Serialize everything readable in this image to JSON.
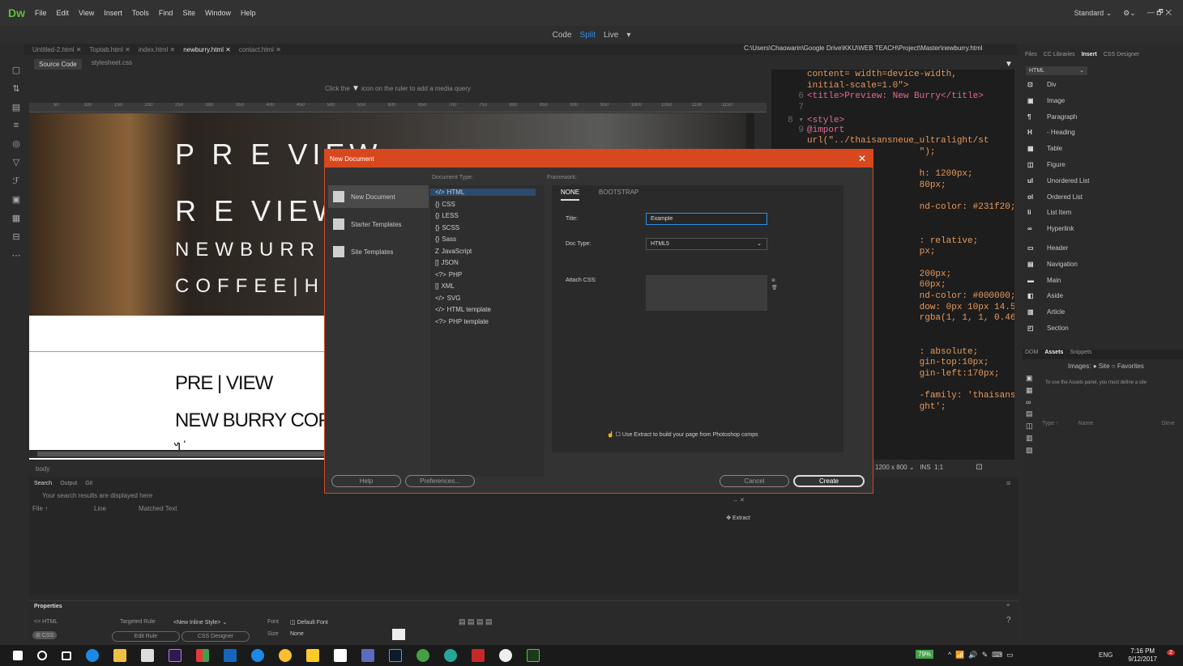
{
  "app": {
    "logo": "Dw",
    "menu": [
      "File",
      "Edit",
      "View",
      "Insert",
      "Tools",
      "Find",
      "Site",
      "Window",
      "Help"
    ],
    "workspace": "Standard",
    "workspace_caret": "⌄",
    "sync_icon": "⚙⌄",
    "win_controls": "—   🗗   ✕"
  },
  "view_modes": {
    "code": "Code",
    "split": "Split",
    "live": "Live",
    "caret": "▾"
  },
  "tabs": [
    "Untitled-2.html",
    "Toptab.html",
    "index.html",
    "newburry.html",
    "contact.html"
  ],
  "tab_close": "✕",
  "active_tab": "newburry.html",
  "file_path": "C:\\Users\\Chaowarin\\Google Drive\\KKU\\WEB TEACH\\Project\\Master\\newburry.html",
  "filter_icon": "▼",
  "sub_tabs": {
    "source": "Source Code",
    "css": "stylesheet.css"
  },
  "media_query_hint": {
    "before": "Click the",
    "after": "icon on the ruler to add a media query"
  },
  "ruler_ticks": [
    "50",
    "100",
    "150",
    "200",
    "250",
    "300",
    "350",
    "400",
    "450",
    "500",
    "550",
    "600",
    "650",
    "700",
    "750",
    "800",
    "850",
    "900",
    "950",
    "1000",
    "1050",
    "1100",
    "1150"
  ],
  "page": {
    "h1": "P R E VIEW",
    "h2": "R   E VIEW",
    "h3": "NEWBURR",
    "h4": "COFFEE|H",
    "lower1": "PRE | VIEW",
    "lower2": "NEW BURRY COF",
    "lower3": "ไ   ่ .   ."
  },
  "code_lines": [
    {
      "n": "",
      "t": "content= width=device-width,"
    },
    {
      "n": "",
      "t": "initial-scale=1.0\">"
    },
    {
      "n": "6",
      "t": "<title>Preview: New Burry</title>"
    },
    {
      "n": "7",
      "t": ""
    },
    {
      "n": "8 ▾",
      "t": "<style>"
    },
    {
      "n": "9",
      "t": "@import"
    },
    {
      "n": "",
      "t": "url(\"../thaisansneue_ultralight/st"
    },
    {
      "n": "",
      "t": "                     \");"
    },
    {
      "n": "",
      "t": ""
    },
    {
      "n": "",
      "t": "                     h: 1200px;"
    },
    {
      "n": "",
      "t": "                     80px;"
    },
    {
      "n": "",
      "t": ""
    },
    {
      "n": "",
      "t": "                     nd-color: #231f20;"
    },
    {
      "n": "",
      "t": ""
    },
    {
      "n": "",
      "t": ""
    },
    {
      "n": "",
      "t": "                     : relative;"
    },
    {
      "n": "",
      "t": "                     px;"
    },
    {
      "n": "",
      "t": ""
    },
    {
      "n": "",
      "t": "                     200px;"
    },
    {
      "n": "",
      "t": "                     60px;"
    },
    {
      "n": "",
      "t": "                     nd-color: #000000;"
    },
    {
      "n": "",
      "t": "                     dow: 0px 10px 14.58px"
    },
    {
      "n": "",
      "t": "                     rgba(1, 1, 1, 0.46);"
    },
    {
      "n": "",
      "t": ""
    },
    {
      "n": "",
      "t": ""
    },
    {
      "n": "",
      "t": "                     : absolute;"
    },
    {
      "n": "",
      "t": "                     gin-top:10px;"
    },
    {
      "n": "",
      "t": "                     gin-left:170px;"
    },
    {
      "n": "",
      "t": ""
    },
    {
      "n": "",
      "t": "                     -family: 'thaisansneue"
    },
    {
      "n": "",
      "t": "                     ght';"
    }
  ],
  "status": {
    "size": "1200 x 800",
    "size_caret": "⌄",
    "mode": "INS",
    "pos": "1:1",
    "preview_icon": "⊡"
  },
  "body_label": "body",
  "bottom_panel": {
    "tabs": [
      "Search",
      "Output",
      "Git"
    ],
    "hint": "Your search results are displayed here",
    "cols": [
      "File ↑",
      "Line",
      "Matched Text"
    ],
    "menu_icon": "≡"
  },
  "extract": {
    "label": "Extract",
    "icon": "✥",
    "controls": "↔ ✕"
  },
  "properties": {
    "title": "Properties",
    "html_btn": "<> HTML",
    "css_btn": "CSS",
    "targeted_rule_label": "Targeted Rule",
    "targeted_rule": "<New Inline Style>",
    "font_label": "Font",
    "font": "Default Font",
    "size_label": "Size",
    "size": "None",
    "edit_rule": "Edit Rule",
    "css_designer": "CSS Designer",
    "caret": "⌄",
    "align_icons": "▤ ▤ ▤ ▤",
    "help_icon": "?",
    "menu_icon": "≡"
  },
  "right_panel": {
    "tabs": [
      "Files",
      "CC Libraries",
      "Insert",
      "CSS Designer"
    ],
    "selector": "HTML",
    "selector_caret": "⌄",
    "items": [
      {
        "icon": "div-icon",
        "label": "Div",
        "glyph": "⊡"
      },
      {
        "icon": "image-icon",
        "label": "Image",
        "glyph": "▣"
      },
      {
        "icon": "paragraph-icon",
        "label": "Paragraph",
        "glyph": "¶"
      },
      {
        "icon": "heading-icon",
        "label": "- Heading",
        "glyph": "H"
      },
      {
        "icon": "table-icon",
        "label": "Table",
        "glyph": "▦"
      },
      {
        "icon": "figure-icon",
        "label": "Figure",
        "glyph": "◫"
      },
      {
        "icon": "ul-icon",
        "label": "Unordered List",
        "glyph": "ul"
      },
      {
        "icon": "ol-icon",
        "label": "Ordered List",
        "glyph": "ol"
      },
      {
        "icon": "li-icon",
        "label": "List Item",
        "glyph": "li"
      },
      {
        "icon": "link-icon",
        "label": "Hyperlink",
        "glyph": "∞"
      },
      {
        "icon": "header-icon",
        "label": "Header",
        "glyph": "▭"
      },
      {
        "icon": "nav-icon",
        "label": "Navigation",
        "glyph": "▤"
      },
      {
        "icon": "main-icon",
        "label": "Main",
        "glyph": "▬"
      },
      {
        "icon": "aside-icon",
        "label": "Aside",
        "glyph": "◧"
      },
      {
        "icon": "article-icon",
        "label": "Article",
        "glyph": "▥"
      },
      {
        "icon": "section-icon",
        "label": "Section",
        "glyph": "◰"
      }
    ],
    "lower_tabs": [
      "DOM",
      "Assets",
      "Snippets"
    ],
    "images_label": "Images:",
    "site": "Site",
    "favorites": "Favorites",
    "assets_note": "To use the Assets panel, you must define a site",
    "cols": [
      "Type ↑",
      "Name",
      "Dime"
    ]
  },
  "dialog": {
    "title": "New Document",
    "close": "✕",
    "categories": [
      "New Document",
      "Starter Templates",
      "Site Templates"
    ],
    "doc_type_label": "Document Type:",
    "doc_types": [
      {
        "g": "</>",
        "t": "HTML"
      },
      {
        "g": "{}",
        "t": "CSS"
      },
      {
        "g": "{}",
        "t": "LESS"
      },
      {
        "g": "{}",
        "t": "SCSS"
      },
      {
        "g": "{}",
        "t": "Sass"
      },
      {
        "g": "Z",
        "t": "JavaScript"
      },
      {
        "g": "[]",
        "t": "JSON"
      },
      {
        "g": "<?>",
        "t": "PHP"
      },
      {
        "g": "[]",
        "t": "XML"
      },
      {
        "g": "</>",
        "t": "SVG"
      },
      {
        "g": "</>",
        "t": "HTML template"
      },
      {
        "g": "<?>",
        "t": "PHP template"
      }
    ],
    "framework_label": "Framework:",
    "framework_none": "NONE",
    "framework_bootstrap": "BOOTSTRAP",
    "title_label": "Title:",
    "title_value": "Example",
    "doctype_label": "Doc Type:",
    "doctype_value": "HTML5",
    "caret": "⌄",
    "attach_label": "Attach CSS:",
    "attach_icons": "⊕\n🗑",
    "extract_check": "Use Extract to build your page from Photoshop comps",
    "help": "Help",
    "prefs": "Preferences...",
    "cancel": "Cancel",
    "create": "Create"
  },
  "taskbar": {
    "battery": "79%",
    "lang": "ENG",
    "time": "7:16 PM",
    "date": "9/12/2017",
    "notifications": "2",
    "tray_glyphs": "^  📶  🔊  ✎  ⌨  ▭"
  },
  "colors": {
    "accent": "#d8481f",
    "blue": "#2e8fe8",
    "dwgreen": "#5fbf3a"
  }
}
